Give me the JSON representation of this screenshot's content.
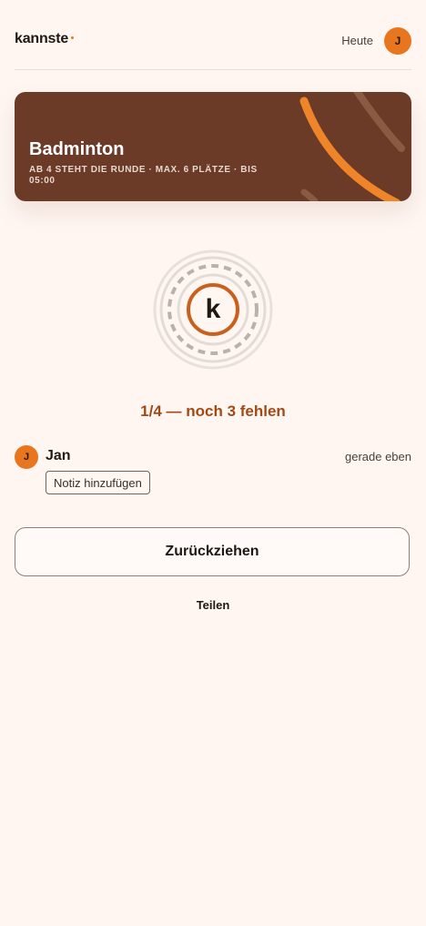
{
  "header": {
    "logo": "kannste",
    "today_label": "Heute",
    "avatar_initial": "J"
  },
  "event": {
    "title": "Badminton",
    "subtitle": "AB 4 STEHT DIE RUNDE · MAX. 6 PLÄTZE · BIS 05:00"
  },
  "emblem": {
    "letter": "k",
    "accent": "#c9601d"
  },
  "status": {
    "text": "1/4 — noch 3 fehlen",
    "current": 1,
    "needed": 4
  },
  "participants": [
    {
      "initial": "J",
      "name": "Jan",
      "time": "gerade eben",
      "note_button": "Notiz hinzufügen"
    }
  ],
  "actions": {
    "withdraw_label": "Zurückziehen",
    "share_label": "Teilen"
  },
  "colors": {
    "background": "#fff6f2",
    "card": "#6b3b28",
    "accent_orange": "#e8761e",
    "status_text": "#a24a14"
  }
}
